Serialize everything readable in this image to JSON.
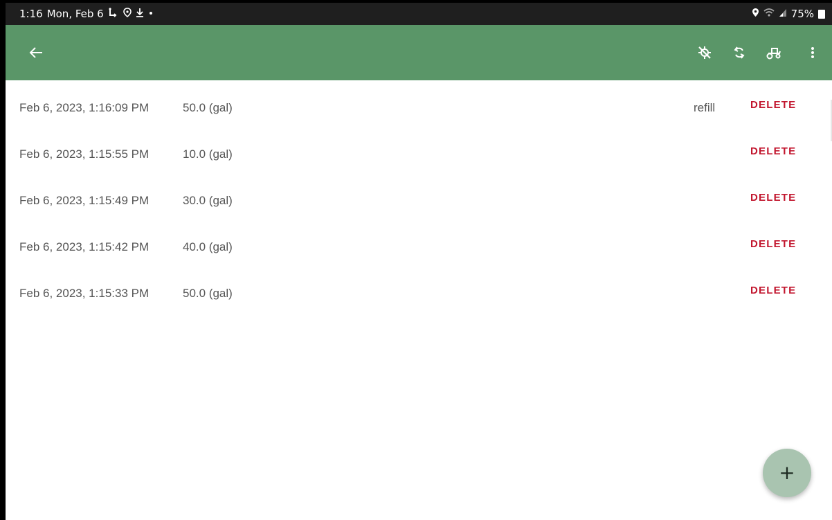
{
  "status_bar": {
    "time": "1:16",
    "date": "Mon, Feb 6",
    "battery": "75%"
  },
  "toolbar": {
    "back_icon": "arrow-left-icon",
    "actions": [
      "gps-off-icon",
      "sync-icon",
      "tractor-icon",
      "more-vert-icon"
    ]
  },
  "entries": [
    {
      "date": "Feb 6, 2023, 1:16:09 PM",
      "amount": "50.0 (gal)",
      "note": "refill",
      "delete_label": "DELETE"
    },
    {
      "date": "Feb 6, 2023, 1:15:55 PM",
      "amount": "10.0 (gal)",
      "note": "",
      "delete_label": "DELETE"
    },
    {
      "date": "Feb 6, 2023, 1:15:49 PM",
      "amount": "30.0 (gal)",
      "note": "",
      "delete_label": "DELETE"
    },
    {
      "date": "Feb 6, 2023, 1:15:42 PM",
      "amount": "40.0 (gal)",
      "note": "",
      "delete_label": "DELETE"
    },
    {
      "date": "Feb 6, 2023, 1:15:33 PM",
      "amount": "50.0 (gal)",
      "note": "",
      "delete_label": "DELETE"
    }
  ],
  "fab": {
    "label": "+"
  },
  "colors": {
    "toolbar": "#5a9668",
    "delete": "#c2162e",
    "fab": "#a9c4b0"
  }
}
